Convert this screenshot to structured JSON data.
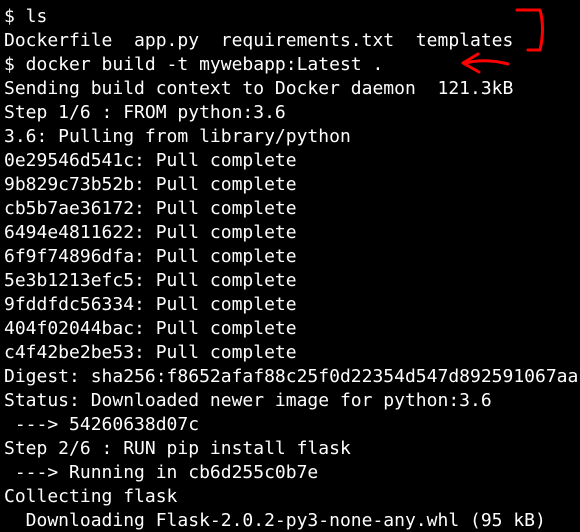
{
  "colors": {
    "background": "#000000",
    "text": "#ffffff",
    "annotation": "#ff0000"
  },
  "terminal": {
    "lines": [
      "$ ls",
      "Dockerfile  app.py  requirements.txt  templates",
      "$ docker build -t mywebapp:Latest .",
      "Sending build context to Docker daemon  121.3kB",
      "Step 1/6 : FROM python:3.6",
      "3.6: Pulling from library/python",
      "0e29546d541c: Pull complete",
      "9b829c73b52b: Pull complete",
      "cb5b7ae36172: Pull complete",
      "6494e4811622: Pull complete",
      "6f9f74896dfa: Pull complete",
      "5e3b1213efc5: Pull complete",
      "9fddfdc56334: Pull complete",
      "404f02044bac: Pull complete",
      "c4f42be2be53: Pull complete",
      "Digest: sha256:f8652afaf88c25f0d22354d547d892591067aa",
      "Status: Downloaded newer image for python:3.6",
      " ---> 54260638d07c",
      "Step 2/6 : RUN pip install flask",
      " ---> Running in cb6d255c0b7e",
      "Collecting flask",
      "  Downloading Flask-2.0.2-py3-none-any.whl (95 kB)"
    ]
  },
  "annotations": {
    "bracket": "bracket-mark",
    "arrow": "left-arrow-mark"
  }
}
